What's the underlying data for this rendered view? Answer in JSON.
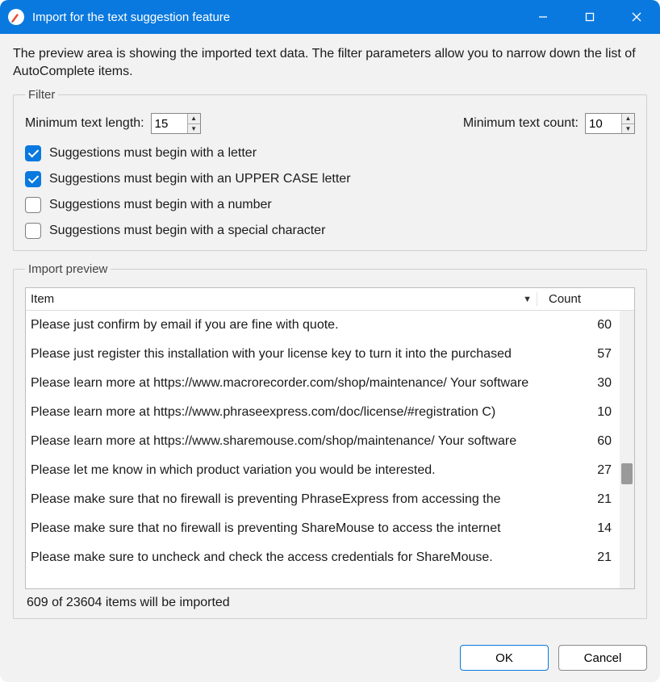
{
  "window": {
    "title": "Import for the text suggestion feature"
  },
  "intro": "The preview area is showing the imported text data. The filter parameters allow you to narrow down the list of AutoComplete items.",
  "filter": {
    "legend": "Filter",
    "min_length_label": "Minimum text length:",
    "min_length_value": "15",
    "min_count_label": "Minimum text count:",
    "min_count_value": "10",
    "checks": [
      {
        "label": "Suggestions must begin with a letter",
        "checked": true
      },
      {
        "label": "Suggestions must begin with an UPPER CASE letter",
        "checked": true
      },
      {
        "label": "Suggestions must begin with a number",
        "checked": false
      },
      {
        "label": "Suggestions must begin with a special character",
        "checked": false
      }
    ]
  },
  "preview": {
    "legend": "Import preview",
    "columns": {
      "item": "Item",
      "count": "Count"
    },
    "rows": [
      {
        "item": "Please just confirm by email if you are fine with quote.",
        "count": "60"
      },
      {
        "item": "Please just register this installation with your license key to turn it into the purchased",
        "count": "57"
      },
      {
        "item": "Please learn more at https://www.macrorecorder.com/shop/maintenance/ Your software",
        "count": "30"
      },
      {
        "item": "Please learn more at https://www.phraseexpress.com/doc/license/#registration C)",
        "count": "10"
      },
      {
        "item": "Please learn more at https://www.sharemouse.com/shop/maintenance/ Your software",
        "count": "60"
      },
      {
        "item": "Please let me know in which product variation you would be interested.",
        "count": "27"
      },
      {
        "item": "Please make sure that no firewall is preventing PhraseExpress from accessing the",
        "count": "21"
      },
      {
        "item": "Please make sure that no firewall is preventing ShareMouse to access the internet",
        "count": "14"
      },
      {
        "item": "Please make sure to uncheck and check the access credentials for ShareMouse.",
        "count": "21"
      }
    ],
    "status": "609 of 23604 items will be imported"
  },
  "buttons": {
    "ok": "OK",
    "cancel": "Cancel"
  }
}
